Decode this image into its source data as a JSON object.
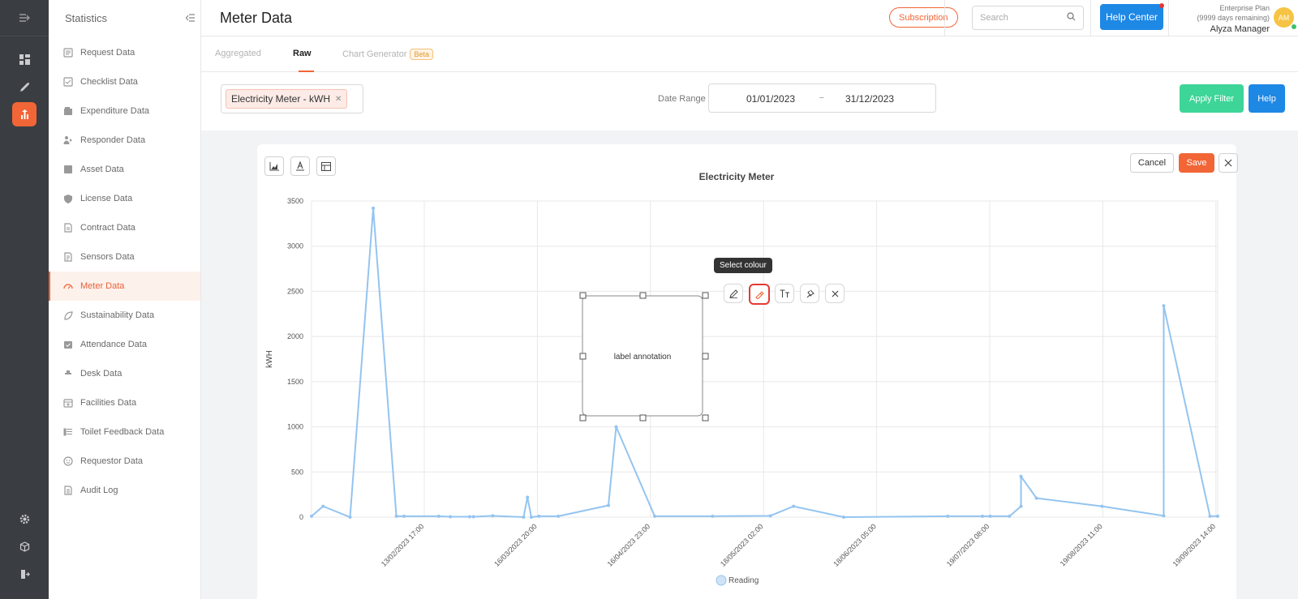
{
  "sidebar": {
    "title": "Statistics",
    "items": [
      {
        "label": "Request Data"
      },
      {
        "label": "Checklist Data"
      },
      {
        "label": "Expenditure Data"
      },
      {
        "label": "Responder Data"
      },
      {
        "label": "Asset Data"
      },
      {
        "label": "License Data"
      },
      {
        "label": "Contract Data"
      },
      {
        "label": "Sensors Data"
      },
      {
        "label": "Meter Data",
        "active": true
      },
      {
        "label": "Sustainability Data"
      },
      {
        "label": "Attendance Data"
      },
      {
        "label": "Desk Data"
      },
      {
        "label": "Facilities Data"
      },
      {
        "label": "Toilet Feedback Data"
      },
      {
        "label": "Requestor Data"
      },
      {
        "label": "Audit Log"
      }
    ]
  },
  "header": {
    "title": "Meter Data",
    "subscription_label": "Subscription",
    "search_placeholder": "Search",
    "help_center_label": "Help Center",
    "plan_name": "Enterprise Plan",
    "plan_remaining": "(9999 days remaining)",
    "user_name": "Alyza Manager",
    "avatar_initials": "AM"
  },
  "tabs": [
    {
      "label": "Aggregated"
    },
    {
      "label": "Raw",
      "active": true
    },
    {
      "label": "Chart Generator",
      "badge": "Beta"
    }
  ],
  "filter": {
    "selected_meter": "Electricity Meter - kWH",
    "date_range_label": "Date Range",
    "date_from": "01/01/2023",
    "date_separator": "–",
    "date_to": "31/12/2023",
    "apply_label": "Apply Filter",
    "help_label": "Help"
  },
  "editor": {
    "cancel_label": "Cancel",
    "save_label": "Save",
    "annotation_text": "label annotation",
    "tooltip_text": "Select colour"
  },
  "colors": {
    "accent": "#f26536",
    "line": "#94c4f0",
    "apply": "#3dd598",
    "primary": "#1e88e5"
  },
  "chart_data": {
    "type": "line",
    "title": "Electricity Meter",
    "xlabel": "",
    "ylabel": "kWH",
    "ylim": [
      0,
      3500
    ],
    "yticks": [
      0,
      500,
      1000,
      1500,
      2000,
      2500,
      3000,
      3500
    ],
    "xtick_labels": [
      "13/02/2023 17:00",
      "16/03/2023 20:00",
      "16/04/2023 23:00",
      "18/05/2023 02:00",
      "18/06/2023 05:00",
      "19/07/2023 08:00",
      "19/08/2023 11:00",
      "19/09/2023 14:00"
    ],
    "grid": true,
    "legend": "bottom",
    "series": [
      {
        "name": "Reading",
        "points": [
          {
            "x": "2023-01-01",
            "y": 10
          },
          {
            "x": "2023-01-04",
            "y": 120
          },
          {
            "x": "2023-01-11",
            "y": 0
          },
          {
            "x": "2023-01-17",
            "y": 3420
          },
          {
            "x": "2023-01-23",
            "y": 10
          },
          {
            "x": "2023-01-25",
            "y": 10
          },
          {
            "x": "2023-02-03",
            "y": 10
          },
          {
            "x": "2023-02-06",
            "y": 5
          },
          {
            "x": "2023-02-11",
            "y": 5
          },
          {
            "x": "2023-02-12",
            "y": 5
          },
          {
            "x": "2023-02-17",
            "y": 15
          },
          {
            "x": "2023-02-25",
            "y": 0
          },
          {
            "x": "2023-02-26",
            "y": 220
          },
          {
            "x": "2023-02-27",
            "y": 0
          },
          {
            "x": "2023-03-01",
            "y": 10
          },
          {
            "x": "2023-03-06",
            "y": 10
          },
          {
            "x": "2023-03-19",
            "y": 130
          },
          {
            "x": "2023-03-21",
            "y": 1000
          },
          {
            "x": "2023-03-31",
            "y": 10
          },
          {
            "x": "2023-04-15",
            "y": 10
          },
          {
            "x": "2023-04-30",
            "y": 15
          },
          {
            "x": "2023-05-06",
            "y": 120
          },
          {
            "x": "2023-05-19",
            "y": 0
          },
          {
            "x": "2023-06-15",
            "y": 10
          },
          {
            "x": "2023-06-24",
            "y": 10
          },
          {
            "x": "2023-06-26",
            "y": 10
          },
          {
            "x": "2023-07-01",
            "y": 10
          },
          {
            "x": "2023-07-04",
            "y": 120
          },
          {
            "x": "2023-07-04",
            "y": 450
          },
          {
            "x": "2023-07-08",
            "y": 210
          },
          {
            "x": "2023-07-25",
            "y": 120
          },
          {
            "x": "2023-08-10",
            "y": 15
          },
          {
            "x": "2023-08-10",
            "y": 2340
          },
          {
            "x": "2023-08-22",
            "y": 10
          },
          {
            "x": "2023-08-24",
            "y": 10
          }
        ]
      }
    ]
  }
}
